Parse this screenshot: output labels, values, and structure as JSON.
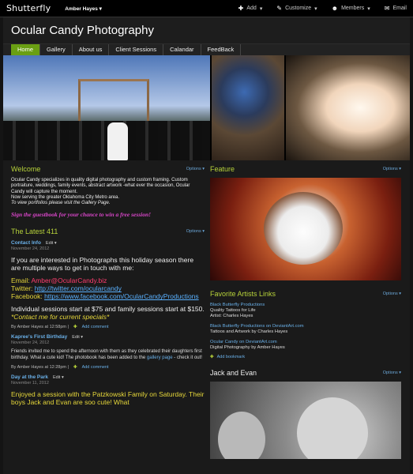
{
  "topbar": {
    "logo": "Shutterfly",
    "user": "Amber Hayes",
    "user_caret": "▾",
    "add": "Add",
    "add_caret": "▾",
    "customize": "Customize",
    "customize_caret": "▾",
    "members": "Members",
    "members_caret": "▾",
    "email": "Email",
    "icons": {
      "add": "plus-icon",
      "customize": "wrench-icon",
      "members": "person-icon",
      "email": "envelope-icon"
    }
  },
  "site": {
    "title": "Ocular Candy Photography"
  },
  "nav": [
    "Home",
    "Gallery",
    "About us",
    "Client Sessions",
    "Calandar",
    "FeedBack"
  ],
  "welcome": {
    "heading": "Welcome",
    "options": "Options ▾",
    "body": "Ocular Candy specializes in quality digital photography and custom framing. Custom portraiture, weddings, family events, abstract artwork -what ever the occasion, Ocular Candy will capture the moment.",
    "serving": "Now serving the greater Oklahoma City Metro area.",
    "portfolios": "To view portfolios please visit the Gallery Page.",
    "guestbook": "Sign the guestbook for your chance to win a free session!"
  },
  "latest": {
    "heading": "The Latest 411",
    "options": "Options ▾",
    "posts": [
      {
        "title": "Contact Info",
        "edit": "Edit ▾",
        "date": "November 24, 2012",
        "intro": "If you are interested in Photographs this holiday season there are multiple ways to get in touch with me:",
        "email_label": "Email: ",
        "email": "Amber@OcularCandy.biz",
        "twitter_label": "Twitter: ",
        "twitter": "http://twitter.com/ocularcandy",
        "facebook_label": "Facebook: ",
        "facebook": "https://www.facebook.com/OcularCandyProductions",
        "pricing": "Individual sessions start at $75 and family sessions start at $150. ",
        "specials": "*Contact me for current specials*",
        "by": "By Amber Hayes at 12:58pm |",
        "add_comment": "Add comment"
      },
      {
        "title": "Kapree's First Birthday",
        "edit": "Edit ▾",
        "date": "November 24, 2012",
        "body": "Friends invited me to spend the afternoon with them as they celebrated their daughters first birthday. What a cute kid! The photobook has been added to the ",
        "link": "gallery page",
        "tail": " - check it out!",
        "by": "By Amber Hayes at 12:28pm |",
        "add_comment": "Add comment"
      },
      {
        "title": "Day at the Park",
        "edit": "Edit ▾",
        "date": "November 11, 2012",
        "body": "Enjoyed a session with the Patzkowski Family on Saturday. Their boys Jack and Evan are soo cute! What"
      }
    ]
  },
  "feature": {
    "heading": "Feature",
    "options": "Options ▾"
  },
  "favorites": {
    "heading": "Favorite Artists Links",
    "options": "Options ▾",
    "links": [
      {
        "name": "Black Butterfly Productions",
        "line2": "Quality Tattoos for Life",
        "line3": "Artist: Charles Hayes"
      },
      {
        "name": "Black Butterfly Productions on DeviantArt.com",
        "line2": "Tattoos and Artwork by Charles Hayes",
        "line3": ""
      },
      {
        "name": "Ocular Candy on DeviantArt.com",
        "line2": "Digital Photography by Amber Hayes",
        "line3": ""
      }
    ],
    "add_bookmark": "Add bookmark"
  },
  "jack": {
    "heading": "Jack and Evan",
    "options": "Options ▾"
  }
}
